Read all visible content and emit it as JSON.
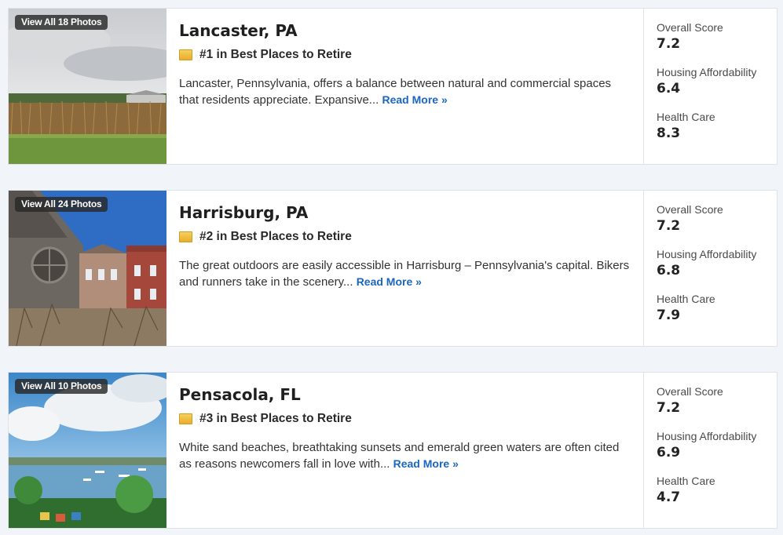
{
  "places": [
    {
      "photos_label": "View All 18 Photos",
      "city": "Lancaster, PA",
      "rank": "#1 in Best Places to Retire",
      "description": "Lancaster, Pennsylvania, offers a balance between natural and commercial spaces that residents appreciate. Expansive...",
      "read_more": "Read More »",
      "scores": [
        {
          "label": "Overall Score",
          "value": "7.2"
        },
        {
          "label": "Housing Affordability",
          "value": "6.4"
        },
        {
          "label": "Health Care",
          "value": "8.3"
        }
      ]
    },
    {
      "photos_label": "View All 24 Photos",
      "city": "Harrisburg, PA",
      "rank": "#2 in Best Places to Retire",
      "description": "The great outdoors are easily accessible in Harrisburg – Pennsylvania's capital. Bikers and runners take in the scenery...",
      "read_more": "Read More »",
      "scores": [
        {
          "label": "Overall Score",
          "value": "7.2"
        },
        {
          "label": "Housing Affordability",
          "value": "6.8"
        },
        {
          "label": "Health Care",
          "value": "7.9"
        }
      ]
    },
    {
      "photos_label": "View All 10 Photos",
      "city": "Pensacola, FL",
      "rank": "#3 in Best Places to Retire",
      "description": "White sand beaches, breathtaking sunsets and emerald green waters are often cited as reasons newcomers fall in love with...",
      "read_more": "Read More »",
      "scores": [
        {
          "label": "Overall Score",
          "value": "7.2"
        },
        {
          "label": "Housing Affordability",
          "value": "6.9"
        },
        {
          "label": "Health Care",
          "value": "4.7"
        }
      ]
    }
  ],
  "colors": {
    "link": "#1a66c1",
    "rank_icon": "#f0bf3f",
    "background": "#f1f4f8"
  }
}
